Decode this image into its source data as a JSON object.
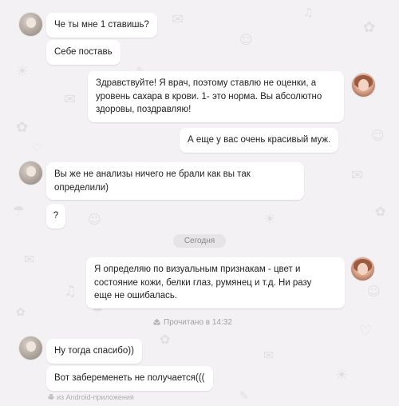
{
  "messages": [
    {
      "side": "in",
      "text": "Че ты мне 1 ставишь?"
    },
    {
      "side": "in",
      "text": "Себе поставь"
    },
    {
      "side": "out",
      "lines": [
        "Здравствуйте! Я врач, поэтому ставлю не оценки, а",
        "уровень сахара в крови. 1- это норма. Вы абсолютно",
        "здоровы, поздравляю!"
      ]
    },
    {
      "side": "out",
      "text": "А еще у вас очень красивый муж."
    },
    {
      "side": "in",
      "lines": [
        "Вы же не анализы ничего не брали как вы так",
        "определили)"
      ]
    },
    {
      "side": "in",
      "text": "?"
    },
    {
      "side": "out",
      "lines": [
        "Я определяю по визуальным признакам - цвет и",
        "состояние кожи, белки глаз, румянец и т.д. Ни разу",
        "еще не ошибалась."
      ]
    },
    {
      "side": "in",
      "text": "Ну тогда спасибо))"
    },
    {
      "side": "in",
      "text": "Вот забеременеть не получается((("
    }
  ],
  "date_separator": "Сегодня",
  "read_status": "Прочитано в 14:32",
  "footer_note": "из Android-приложения",
  "colors": {
    "background": "#f3f1f4",
    "bubble": "#ffffff",
    "doodle": "#e2dfe3"
  }
}
